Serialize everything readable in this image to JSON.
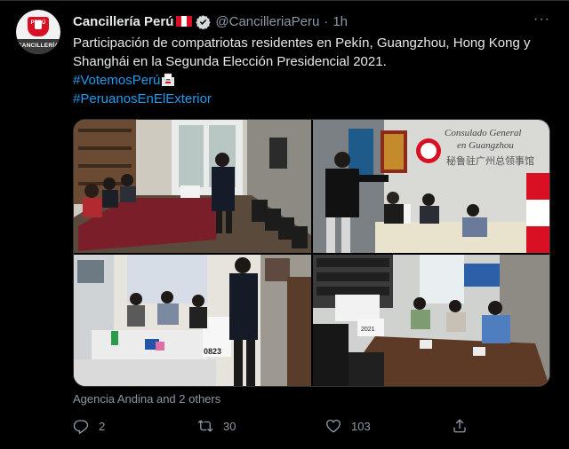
{
  "tweet": {
    "display_name": "Cancillería Perú",
    "handle": "@CancilleriaPeru",
    "separator": "·",
    "time": "1h",
    "text_line1": "Participación de compatriotas residentes en Pekín, Guangzhou, Hong Kong y",
    "text_line2": "Shanghái en la Segunda Elección Presidencial 2021.",
    "hashtag1": "#VotemosPerú",
    "hashtag2": "#PeruanosEnElExterior",
    "tagged": "Agencia Andina and 2 others",
    "reply_count": "2",
    "retweet_count": "30",
    "like_count": "103",
    "more_label": "···"
  },
  "avatar": {
    "shield_text": "PERÚ",
    "band_text": "CANCILLERÍA"
  },
  "photos": {
    "p2_sign_line1": "Consulado General",
    "p2_sign_line2": "en Guangzhou",
    "p2_sign_line3": "秘鲁驻广州总领事馆",
    "p3_ballot_label": "0823",
    "p4_box_label": "2021"
  },
  "colors": {
    "background": "#000000",
    "text": "#e7e9ea",
    "muted": "#8b98a5",
    "link": "#1d9bf0",
    "peru_red": "#d91023"
  },
  "icons": {
    "verified": "verified-badge-icon",
    "reply": "reply-icon",
    "retweet": "retweet-icon",
    "like": "heart-icon",
    "share": "share-icon",
    "more": "more-icon",
    "ballot": "ballot-box-emoji",
    "flag": "peru-flag-emoji"
  }
}
